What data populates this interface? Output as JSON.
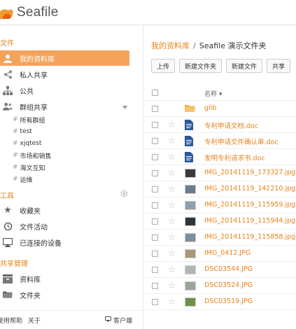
{
  "app": {
    "logo_text": "Seafile"
  },
  "sidebar": {
    "files_title": "文件",
    "items": [
      {
        "label": "我的资料库",
        "icon": "user-icon",
        "active": true
      },
      {
        "label": "私人共享",
        "icon": "share-icon"
      },
      {
        "label": "公共",
        "icon": "org-icon"
      },
      {
        "label": "群组共享",
        "icon": "group-icon"
      }
    ],
    "groups": [
      "所有群组",
      "test",
      "xjqtest",
      "市场和销售",
      "海文互知",
      "运维"
    ],
    "tools_title": "工具",
    "tools": [
      {
        "label": "收藏夹",
        "icon": "star-icon"
      },
      {
        "label": "文件活动",
        "icon": "history-icon"
      },
      {
        "label": "已连接的设备",
        "icon": "monitor-icon"
      }
    ],
    "share_admin_title": "共享管理",
    "share_admin": [
      {
        "label": "资料库",
        "icon": "library-icon"
      },
      {
        "label": "文件夹",
        "icon": "folder-icon"
      }
    ],
    "footer": {
      "help": "使用帮助",
      "about": "关于",
      "client": "客户端"
    }
  },
  "main": {
    "breadcrumb": {
      "root": "我的资料库",
      "separator": "/",
      "current": "Seafile 演示文件夹"
    },
    "toolbar": [
      "上传",
      "新建文件夹",
      "新建文件",
      "共享"
    ],
    "table": {
      "name_header": "名称",
      "rows": [
        {
          "name": "glib",
          "type": "folder"
        },
        {
          "name": "专利申请文档.doc",
          "type": "doc"
        },
        {
          "name": "专利申请文件确认单.doc",
          "type": "doc"
        },
        {
          "name": "发明专利请求书.doc",
          "type": "doc"
        },
        {
          "name": "IMG_20141119_173327.jpg",
          "type": "image",
          "thumb": "#3a3a3a"
        },
        {
          "name": "IMG_20141119_142210.jpg",
          "type": "image",
          "thumb": "#6b7c8f"
        },
        {
          "name": "IMG_20141119_115959.jpg",
          "type": "image",
          "thumb": "#8fa0b0"
        },
        {
          "name": "IMG_20141119_115944.jpg",
          "type": "image",
          "thumb": "#2d3640"
        },
        {
          "name": "IMG_20141119_115858.jpg",
          "type": "image",
          "thumb": "#7d8e9c"
        },
        {
          "name": "IMG_0412.JPG",
          "type": "image",
          "thumb": "#a89878"
        },
        {
          "name": "DSC03544.JPG",
          "type": "image",
          "thumb": "#b0b7b0"
        },
        {
          "name": "DSC03524.JPG",
          "type": "image",
          "thumb": "#9aa59a"
        },
        {
          "name": "DSC03519.JPG",
          "type": "image",
          "thumb": "#6f8f4a"
        }
      ]
    }
  },
  "colors": {
    "accent": "#e8821a",
    "active_bg": "#f3a35c"
  }
}
